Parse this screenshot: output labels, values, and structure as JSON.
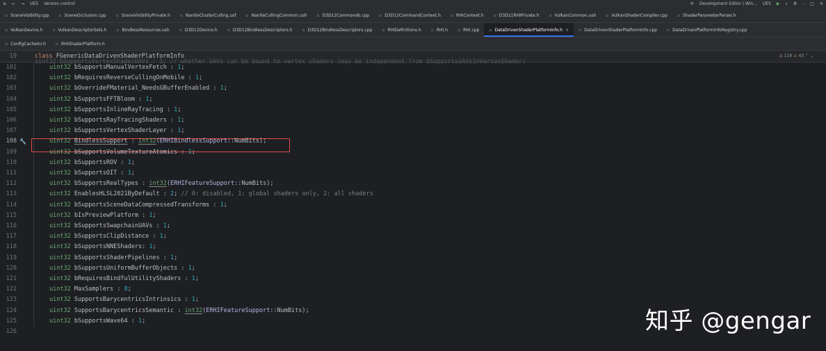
{
  "topbar": {
    "project": "UE5",
    "vcs": "Version control",
    "run_config": "Development Editor | Win...",
    "target": "UE5"
  },
  "tabs_row1": [
    "SceneVisibility.cpp",
    "SceneOcclusion.cpp",
    "SceneVisibilityPrivate.h",
    "NaniteClusterCulling.usf",
    "NaniteCullingCommon.ush",
    "D3D12Commands.cpp",
    "D3D12CommandContext.h",
    "RHIContext.h",
    "D3D11RHIPrivate.h",
    "VulkanCommon.ush",
    "VulkanShaderCompiler.cpp",
    "ShaderParameterParser.h"
  ],
  "tabs_row2": [
    "VulkanDevice.h",
    "VulkanDescriptorSets.h",
    "BindlessResources.ush",
    "D3D12Device.h",
    "D3D12BindlessDescriptors.h",
    "D3D12BindlessDescriptors.cpp",
    "RHIDefinitions.h",
    "RHI.h",
    "RHI.cpp",
    "DataDrivenShaderPlatformInfo.h",
    "DataDrivenShaderPlatformInfo.cpp",
    "DataDrivenPlatformInfoRegistry.cpp"
  ],
  "tabs_row3": [
    "ConfigCacheIni.h",
    "RHIShaderPlatform.h"
  ],
  "active_tab": "DataDrivenShaderPlatformInfo.h",
  "sticky": {
    "line": "19",
    "keyword": "class",
    "name": "FGenericDataDrivenShaderPlatformInfo"
  },
  "inspections": {
    "warnings": "119",
    "weak": "43"
  },
  "cut_line": "uint32 bSupportsVertexShaderUAVs : 1; // whether UAVs can be bound to vertex shaders (may be independent from bSupportsUAVsInVertexShader)",
  "lines": [
    {
      "n": "101",
      "code": [
        {
          "t": "uint32",
          "c": "tp"
        },
        {
          "t": " bSupportsManualVertexFetch : ",
          "c": "fld"
        },
        {
          "t": "1",
          "c": "num"
        },
        {
          "t": ";",
          "c": "fld"
        }
      ]
    },
    {
      "n": "102",
      "code": [
        {
          "t": "uint32",
          "c": "tp"
        },
        {
          "t": " bRequiresReverseCullingOnMobile : ",
          "c": "fld"
        },
        {
          "t": "1",
          "c": "num"
        },
        {
          "t": ";",
          "c": "fld"
        }
      ]
    },
    {
      "n": "103",
      "code": [
        {
          "t": "uint32",
          "c": "tp"
        },
        {
          "t": " bOverrideFMaterial_NeedsGBufferEnabled : ",
          "c": "fld"
        },
        {
          "t": "1",
          "c": "num"
        },
        {
          "t": ";",
          "c": "fld"
        }
      ]
    },
    {
      "n": "104",
      "code": [
        {
          "t": "uint32",
          "c": "tp"
        },
        {
          "t": " bSupportsFFTBloom : ",
          "c": "fld"
        },
        {
          "t": "1",
          "c": "num"
        },
        {
          "t": ";",
          "c": "fld"
        }
      ]
    },
    {
      "n": "105",
      "code": [
        {
          "t": "uint32",
          "c": "tp"
        },
        {
          "t": " bSupportsInlineRayTracing : ",
          "c": "fld"
        },
        {
          "t": "1",
          "c": "num"
        },
        {
          "t": ";",
          "c": "fld"
        }
      ]
    },
    {
      "n": "106",
      "code": [
        {
          "t": "uint32",
          "c": "tp"
        },
        {
          "t": " bSupportsRayTracingShaders : ",
          "c": "fld"
        },
        {
          "t": "1",
          "c": "num"
        },
        {
          "t": ";",
          "c": "fld"
        }
      ]
    },
    {
      "n": "107",
      "code": [
        {
          "t": "uint32",
          "c": "tp"
        },
        {
          "t": " bSupportsVertexShaderLayer : ",
          "c": "fld"
        },
        {
          "t": "1",
          "c": "num"
        },
        {
          "t": ";",
          "c": "fld"
        }
      ]
    },
    {
      "n": "108",
      "current": true,
      "code": [
        {
          "t": "uint32",
          "c": "tp"
        },
        {
          "t": " ",
          "c": "fld"
        },
        {
          "t": "BindlessSupport",
          "c": "fld underline"
        },
        {
          "t": " : ",
          "c": "fld"
        },
        {
          "t": "int32",
          "c": "tp underline"
        },
        {
          "t": "(ERHIBindlessSupport::",
          "c": "ns"
        },
        {
          "t": "NumBits",
          "c": "fld"
        },
        {
          "t": ");",
          "c": "fld"
        }
      ]
    },
    {
      "n": "109",
      "code": [
        {
          "t": "uint32",
          "c": "tp"
        },
        {
          "t": " bSupportsVolumeTextureAtomics : ",
          "c": "fld"
        },
        {
          "t": "1",
          "c": "num"
        },
        {
          "t": ";",
          "c": "fld"
        }
      ]
    },
    {
      "n": "110",
      "code": [
        {
          "t": "uint32",
          "c": "tp"
        },
        {
          "t": " bSupportsROV : ",
          "c": "fld"
        },
        {
          "t": "1",
          "c": "num"
        },
        {
          "t": ";",
          "c": "fld"
        }
      ]
    },
    {
      "n": "111",
      "code": [
        {
          "t": "uint32",
          "c": "tp"
        },
        {
          "t": " bSupportsOIT : ",
          "c": "fld"
        },
        {
          "t": "1",
          "c": "num"
        },
        {
          "t": ";",
          "c": "fld"
        }
      ]
    },
    {
      "n": "112",
      "code": [
        {
          "t": "uint32",
          "c": "tp"
        },
        {
          "t": " bSupportsRealTypes : ",
          "c": "fld"
        },
        {
          "t": "int32",
          "c": "tp underline"
        },
        {
          "t": "(ERHIFeatureSupport::",
          "c": "ns"
        },
        {
          "t": "NumBits",
          "c": "fld"
        },
        {
          "t": ");",
          "c": "fld"
        }
      ]
    },
    {
      "n": "113",
      "code": [
        {
          "t": "uint32",
          "c": "tp"
        },
        {
          "t": " EnablesHLSL2021ByDefault : ",
          "c": "fld"
        },
        {
          "t": "2",
          "c": "num"
        },
        {
          "t": "; ",
          "c": "fld"
        },
        {
          "t": "// 0: disabled, 1: global shaders only, 2: all shaders",
          "c": "cm"
        }
      ]
    },
    {
      "n": "114",
      "code": [
        {
          "t": "uint32",
          "c": "tp"
        },
        {
          "t": " bSupportsSceneDataCompressedTransforms : ",
          "c": "fld"
        },
        {
          "t": "1",
          "c": "num"
        },
        {
          "t": ";",
          "c": "fld"
        }
      ]
    },
    {
      "n": "115",
      "code": [
        {
          "t": "uint32",
          "c": "tp"
        },
        {
          "t": " bIsPreviewPlatform : ",
          "c": "fld"
        },
        {
          "t": "1",
          "c": "num"
        },
        {
          "t": ";",
          "c": "fld"
        }
      ]
    },
    {
      "n": "116",
      "code": [
        {
          "t": "uint32",
          "c": "tp"
        },
        {
          "t": " bSupportsSwapchainUAVs : ",
          "c": "fld"
        },
        {
          "t": "1",
          "c": "num"
        },
        {
          "t": ";",
          "c": "fld"
        }
      ]
    },
    {
      "n": "117",
      "code": [
        {
          "t": "uint32",
          "c": "tp"
        },
        {
          "t": " bSupportsClipDistance : ",
          "c": "fld"
        },
        {
          "t": "1",
          "c": "num"
        },
        {
          "t": ";",
          "c": "fld"
        }
      ]
    },
    {
      "n": "118",
      "code": [
        {
          "t": "uint32",
          "c": "tp"
        },
        {
          "t": " bSupportsNNEShaders: ",
          "c": "fld"
        },
        {
          "t": "1",
          "c": "num"
        },
        {
          "t": ";",
          "c": "fld"
        }
      ]
    },
    {
      "n": "119",
      "code": [
        {
          "t": "uint32",
          "c": "tp"
        },
        {
          "t": " bSupportsShaderPipelines : ",
          "c": "fld"
        },
        {
          "t": "1",
          "c": "num"
        },
        {
          "t": ";",
          "c": "fld"
        }
      ]
    },
    {
      "n": "120",
      "code": [
        {
          "t": "uint32",
          "c": "tp"
        },
        {
          "t": " bSupportsUniformBufferObjects : ",
          "c": "fld"
        },
        {
          "t": "1",
          "c": "num"
        },
        {
          "t": ";",
          "c": "fld"
        }
      ]
    },
    {
      "n": "121",
      "code": [
        {
          "t": "uint32",
          "c": "tp"
        },
        {
          "t": " bRequiresBindfulUtilityShaders : ",
          "c": "fld"
        },
        {
          "t": "1",
          "c": "num"
        },
        {
          "t": ";",
          "c": "fld"
        }
      ]
    },
    {
      "n": "122",
      "code": [
        {
          "t": "uint32",
          "c": "tp"
        },
        {
          "t": " MaxSamplers : ",
          "c": "fld"
        },
        {
          "t": "8",
          "c": "num"
        },
        {
          "t": ";",
          "c": "fld"
        }
      ]
    },
    {
      "n": "123",
      "code": [
        {
          "t": "uint32",
          "c": "tp"
        },
        {
          "t": " SupportsBarycentricsIntrinsics : ",
          "c": "fld"
        },
        {
          "t": "1",
          "c": "num"
        },
        {
          "t": ";",
          "c": "fld"
        }
      ]
    },
    {
      "n": "124",
      "code": [
        {
          "t": "uint32",
          "c": "tp"
        },
        {
          "t": " SupportsBarycentricsSemantic : ",
          "c": "fld"
        },
        {
          "t": "int32",
          "c": "tp underline"
        },
        {
          "t": "(ERHIFeatureSupport::",
          "c": "ns"
        },
        {
          "t": "NumBits",
          "c": "fld"
        },
        {
          "t": ");",
          "c": "fld"
        }
      ]
    },
    {
      "n": "125",
      "code": [
        {
          "t": "uint32",
          "c": "tp"
        },
        {
          "t": " bSupportsWave64 : ",
          "c": "fld"
        },
        {
          "t": "1",
          "c": "num"
        },
        {
          "t": ";",
          "c": "fld"
        }
      ]
    },
    {
      "n": "126",
      "code": []
    }
  ],
  "watermark": "知乎 @gengar"
}
